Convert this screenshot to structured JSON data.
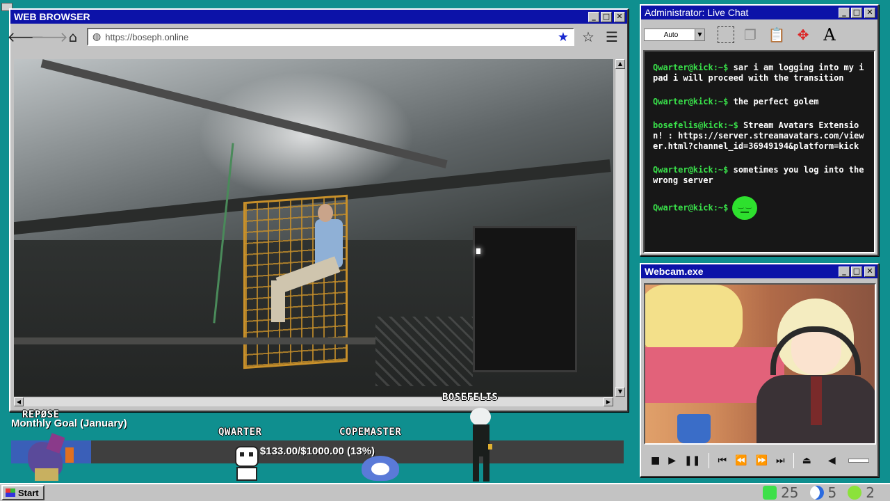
{
  "colors": {
    "titlebar": "#0c12a8",
    "desktop": "#0f8f8f",
    "chat_user": "#39e04a",
    "goal_fill": "#3a5fb8",
    "emote": "#2ee02e"
  },
  "browser": {
    "title": "WEB BROWSER",
    "url": "https://boseph.online",
    "icons": [
      "back-arrow-icon",
      "forward-arrow-icon",
      "home-icon",
      "globe-icon",
      "bookmark-star-icon",
      "favorites-star-icon",
      "hamburger-menu-icon"
    ]
  },
  "chat": {
    "title": "Administrator: Live Chat",
    "font_select": "Auto",
    "messages": [
      {
        "user": "Qwarter@kick:~$",
        "text": "sar i am logging into my ipad i will proceed with the transition"
      },
      {
        "user": "Qwarter@kick:~$",
        "text": "the perfect golem"
      },
      {
        "user": "bosefelis@kick:~$",
        "text": "Stream Avatars Extension! : https://server.streamavatars.com/viewer.html?channel_id=36949194&platform=kick"
      },
      {
        "user": "Qwarter@kick:~$",
        "text": "sometimes you log into the wrong server"
      },
      {
        "user": "Qwarter@kick:~$",
        "text": "",
        "emote": "green-blob-emote"
      }
    ]
  },
  "webcam": {
    "title": "Webcam.exe",
    "controls": [
      "stop-icon",
      "play-icon",
      "pause-icon",
      "skip-start-icon",
      "rewind-icon",
      "fast-forward-icon",
      "skip-end-icon",
      "eject-icon",
      "volume-icon"
    ]
  },
  "goal": {
    "title": "Monthly Goal (January)",
    "text": "$133.00/$1000.00 (13%)",
    "progress": 0.13
  },
  "avatars": [
    {
      "name": "REPØSE"
    },
    {
      "name": "QWARTER"
    },
    {
      "name": "COPEMASTER"
    },
    {
      "name": "BOSEFELIS"
    }
  ],
  "taskbar": {
    "start_label": "Start",
    "tray": [
      {
        "icon": "kick-logo-icon",
        "count": "25"
      },
      {
        "icon": "moon-icon",
        "count": "5"
      },
      {
        "icon": "play-circle-icon",
        "count": "2"
      }
    ]
  }
}
